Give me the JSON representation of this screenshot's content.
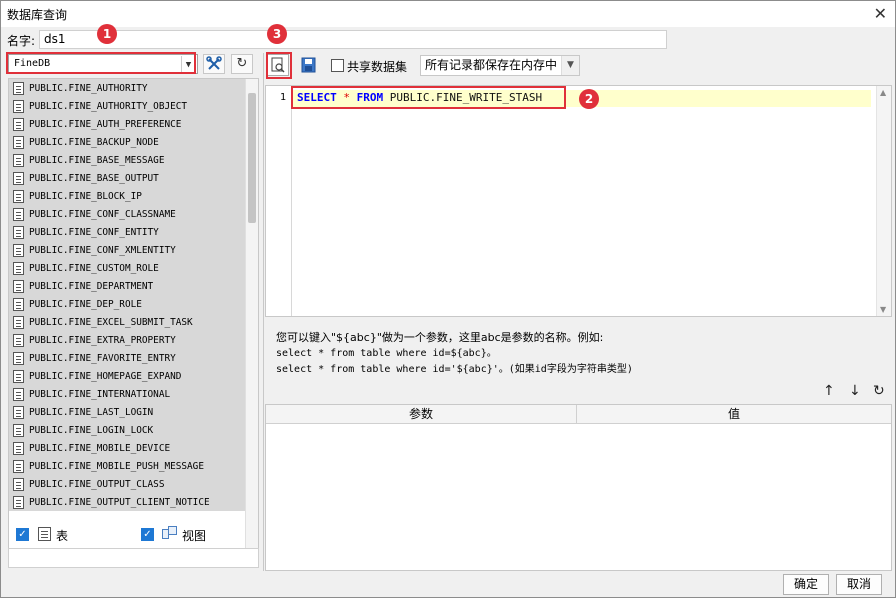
{
  "window": {
    "title": "数据库查询",
    "close": "✕"
  },
  "name_row": {
    "label": "名字:",
    "value": "ds1"
  },
  "left": {
    "connection": "FineDB",
    "tables": [
      "PUBLIC.FINE_AUTHORITY",
      "PUBLIC.FINE_AUTHORITY_OBJECT",
      "PUBLIC.FINE_AUTH_PREFERENCE",
      "PUBLIC.FINE_BACKUP_NODE",
      "PUBLIC.FINE_BASE_MESSAGE",
      "PUBLIC.FINE_BASE_OUTPUT",
      "PUBLIC.FINE_BLOCK_IP",
      "PUBLIC.FINE_CONF_CLASSNAME",
      "PUBLIC.FINE_CONF_ENTITY",
      "PUBLIC.FINE_CONF_XMLENTITY",
      "PUBLIC.FINE_CUSTOM_ROLE",
      "PUBLIC.FINE_DEPARTMENT",
      "PUBLIC.FINE_DEP_ROLE",
      "PUBLIC.FINE_EXCEL_SUBMIT_TASK",
      "PUBLIC.FINE_EXTRA_PROPERTY",
      "PUBLIC.FINE_FAVORITE_ENTRY",
      "PUBLIC.FINE_HOMEPAGE_EXPAND",
      "PUBLIC.FINE_INTERNATIONAL",
      "PUBLIC.FINE_LAST_LOGIN",
      "PUBLIC.FINE_LOGIN_LOCK",
      "PUBLIC.FINE_MOBILE_DEVICE",
      "PUBLIC.FINE_MOBILE_PUSH_MESSAGE",
      "PUBLIC.FINE_OUTPUT_CLASS",
      "PUBLIC.FINE_OUTPUT_CLIENT_NOTICE"
    ],
    "filter_table_label": "表",
    "filter_view_label": "视图"
  },
  "right": {
    "share_label": "共享数据集",
    "mode_select": "所有记录都保存在内存中",
    "line_number": "1",
    "sql": {
      "kw1": "SELECT",
      "star": "*",
      "kw2": "FROM",
      "table": "PUBLIC.FINE_WRITE_STASH"
    },
    "hint_line1": "您可以键入\"${abc}\"做为一个参数，这里abc是参数的名称。例如:",
    "hint_line2": "select * from table where id=${abc}。",
    "hint_line3": "select * from table where id='${abc}'。(如果id字段为字符串类型)",
    "param_col": "参数",
    "value_col": "值"
  },
  "buttons": {
    "ok": "确定",
    "cancel": "取消"
  },
  "badges": {
    "b1": "1",
    "b2": "2",
    "b3": "3"
  },
  "colors": {
    "annotation": "#e0303a",
    "keyword": "#0000ff",
    "checkbox": "#1e78d4"
  }
}
